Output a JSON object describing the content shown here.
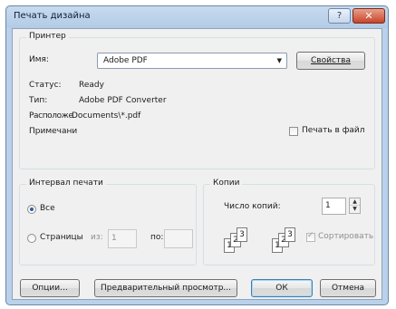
{
  "window": {
    "title": "Печать дизайна",
    "help_label": "?",
    "close_label": "✕"
  },
  "printer": {
    "group_label": "Принтер",
    "name_label": "Имя:",
    "name_value": "Adobe PDF",
    "properties_label": "Свойства",
    "status_label": "Статус:",
    "status_value": "Ready",
    "type_label": "Тип:",
    "type_value": "Adobe PDF Converter",
    "location_label": "Расположе",
    "location_value": "Documents\\*.pdf",
    "comment_label": "Примечани",
    "print_to_file_label": "Печать в файл",
    "print_to_file_checked": false
  },
  "range": {
    "group_label": "Интервал печати",
    "all_label": "Все",
    "all_selected": true,
    "pages_label": "Страницы",
    "from_label": "из:",
    "from_value": "1",
    "to_label": "по:",
    "to_value": ""
  },
  "copies": {
    "group_label": "Копии",
    "count_label": "Число копий:",
    "count_value": "1",
    "collate_label": "Сортировать",
    "collate_checked": true,
    "page_numbers": [
      "1",
      "2",
      "3"
    ]
  },
  "footer": {
    "options_label": "Опции...",
    "preview_label": "Предварительный просмотр...",
    "ok_label": "ОК",
    "cancel_label": "Отмена"
  },
  "colors": {
    "frame": "#b9d1ea",
    "client": "#f0f0f0",
    "close": "#c8442a"
  }
}
